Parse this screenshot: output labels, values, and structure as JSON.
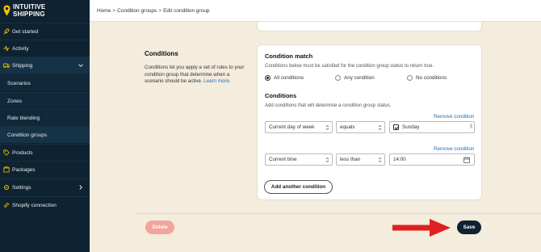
{
  "brand": {
    "line1": "INTUITIVE",
    "line2": "SHIPPING"
  },
  "sidebar": {
    "items": [
      {
        "label": "Get started",
        "icon": "rocket-icon"
      },
      {
        "label": "Activity",
        "icon": "activity-icon"
      },
      {
        "label": "Shipping",
        "icon": "truck-icon"
      },
      {
        "label": "Scenarios"
      },
      {
        "label": "Zones"
      },
      {
        "label": "Rate blending"
      },
      {
        "label": "Condition groups"
      },
      {
        "label": "Products",
        "icon": "tag-icon"
      },
      {
        "label": "Packages",
        "icon": "package-icon"
      },
      {
        "label": "Settings",
        "icon": "gear-icon"
      },
      {
        "label": "Shopify connection",
        "icon": "link-icon"
      }
    ]
  },
  "breadcrumb": {
    "home": "Home",
    "section": "Condition groups",
    "current": "Edit condition group",
    "sep": ">"
  },
  "left": {
    "title": "Conditions",
    "description": "Conditions let you apply a set of rules to your condition group that determine when a scenario should be active.",
    "learn_more": "Learn more."
  },
  "condition_match": {
    "title": "Condition match",
    "description": "Conditions below must be satisfied for the condition group status to return true.",
    "options": [
      "All conditions",
      "Any condition",
      "No conditions"
    ],
    "selected": "All conditions"
  },
  "conditions": {
    "title": "Conditions",
    "description": "Add conditions that will determine a condition group status.",
    "remove_label": "Remove condition",
    "rows": [
      {
        "field": "Current day of week",
        "operator": "equals",
        "value": "Sunday",
        "checked": true
      },
      {
        "field": "Current time",
        "operator": "less than",
        "value": "14:00"
      }
    ],
    "add_label": "Add another condition"
  },
  "footer": {
    "delete_label": "Delete",
    "save_label": "Save"
  },
  "colors": {
    "sidebar_bg": "#0e2231",
    "page_bg": "#f4ecdc",
    "link": "#1e6fb0",
    "delete_bg": "#f2a59c",
    "arrow": "#e02020"
  }
}
